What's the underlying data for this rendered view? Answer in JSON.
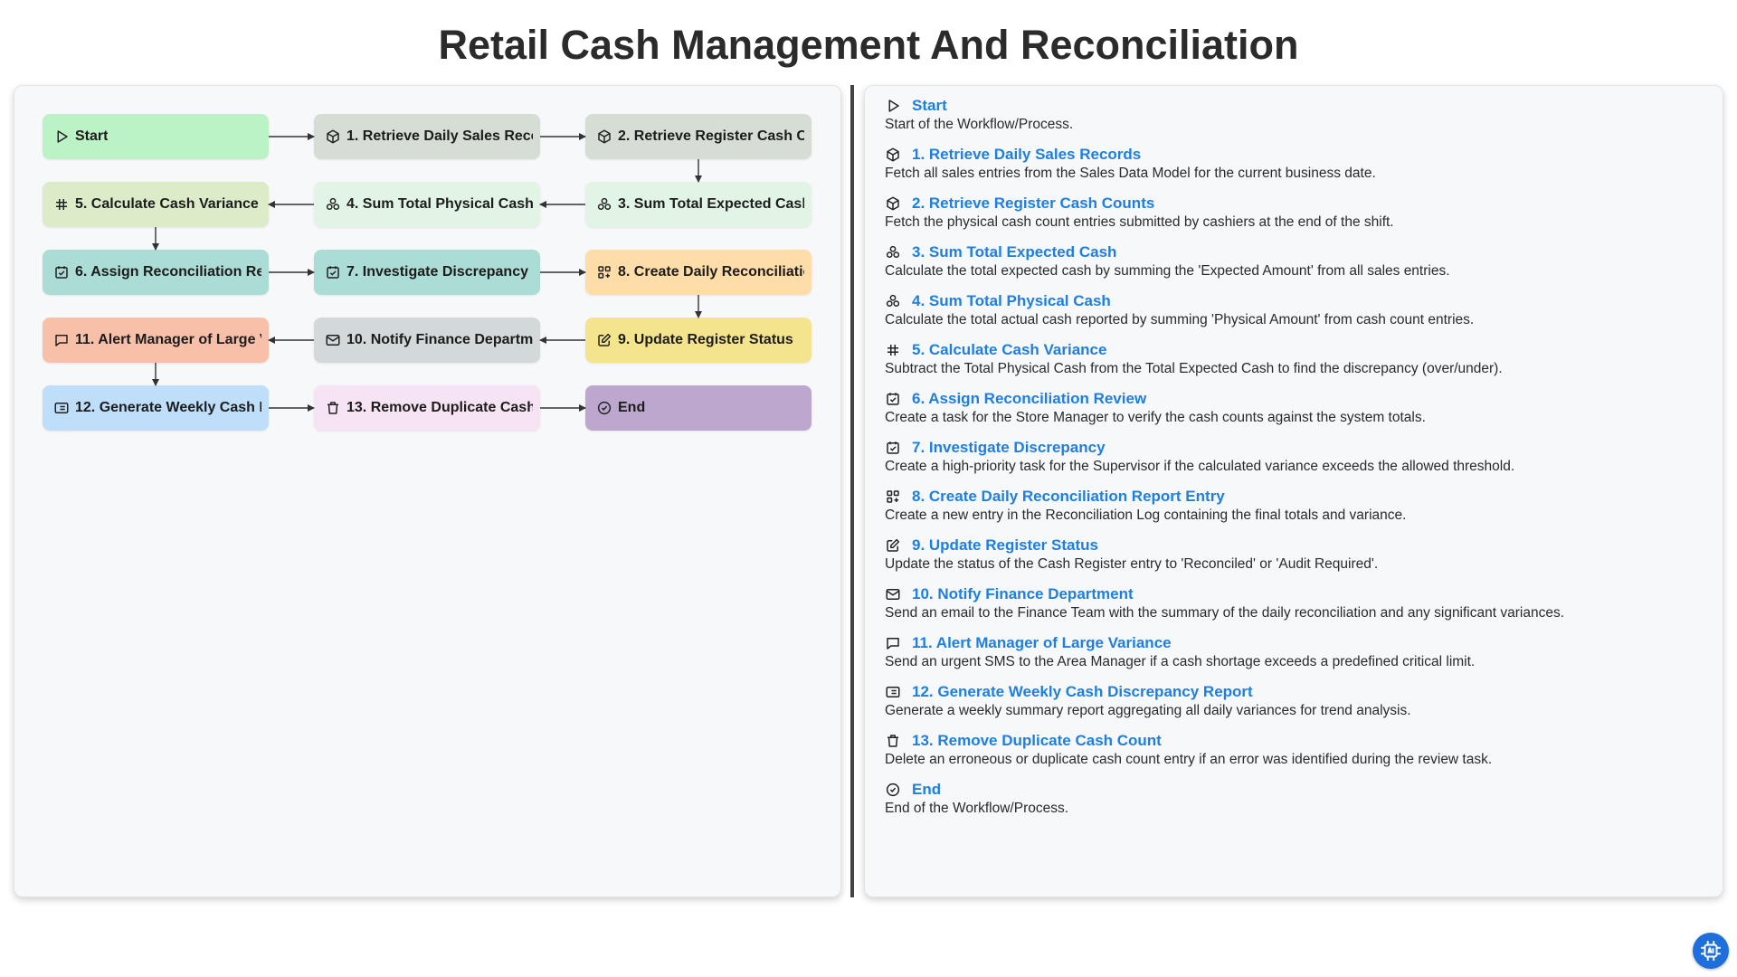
{
  "title": "Retail Cash Management And Reconciliation",
  "colors": {
    "start": "#bcf3c6",
    "retrieve": "#d5ddd4",
    "sum": "#e2f4e6",
    "calculate": "#dcebc8",
    "task": "#acdcd6",
    "report": "#fedda8",
    "update": "#f3e48d",
    "notify": "#d3d8da",
    "alert": "#f9c0a9",
    "weekly": "#bedefa",
    "remove": "#f6e3f3",
    "end": "#bea7cf",
    "link": "#1f7fe0"
  },
  "nodes": [
    {
      "id": "start",
      "label": "Start",
      "icon": "play-icon"
    },
    {
      "id": "s1",
      "label": "1. Retrieve Daily Sales Records",
      "icon": "cube-icon"
    },
    {
      "id": "s2",
      "label": "2. Retrieve Register Cash Counts",
      "icon": "cube-icon"
    },
    {
      "id": "s3",
      "label": "3. Sum Total Expected Cash",
      "icon": "stack-icon"
    },
    {
      "id": "s4",
      "label": "4. Sum Total Physical Cash",
      "icon": "stack-icon"
    },
    {
      "id": "s5",
      "label": "5. Calculate Cash Variance",
      "icon": "hash-icon"
    },
    {
      "id": "s6",
      "label": "6. Assign Reconciliation Review",
      "icon": "checkbox-icon"
    },
    {
      "id": "s7",
      "label": "7. Investigate Discrepancy",
      "icon": "checkbox-icon"
    },
    {
      "id": "s8",
      "label": "8. Create Daily Reconciliation Report Entry",
      "icon": "grid-icon"
    },
    {
      "id": "s9",
      "label": "9. Update Register Status",
      "icon": "edit-icon"
    },
    {
      "id": "s10",
      "label": "10. Notify Finance Department",
      "icon": "mail-icon"
    },
    {
      "id": "s11",
      "label": "11. Alert Manager of Large Variance",
      "icon": "message-icon"
    },
    {
      "id": "s12",
      "label": "12. Generate Weekly Cash Discrepancy Report",
      "icon": "list-icon"
    },
    {
      "id": "s13",
      "label": "13. Remove Duplicate Cash Count",
      "icon": "trash-icon"
    },
    {
      "id": "end",
      "label": "End",
      "icon": "check-circle-icon"
    }
  ],
  "steps": [
    {
      "title": "Start",
      "desc": "Start of the Workflow/Process."
    },
    {
      "title": "1. Retrieve Daily Sales Records",
      "desc": "Fetch all sales entries from the Sales Data Model for the current business date."
    },
    {
      "title": "2. Retrieve Register Cash Counts",
      "desc": "Fetch the physical cash count entries submitted by cashiers at the end of the shift."
    },
    {
      "title": "3. Sum Total Expected Cash",
      "desc": "Calculate the total expected cash by summing the 'Expected Amount' from all sales entries."
    },
    {
      "title": "4. Sum Total Physical Cash",
      "desc": "Calculate the total actual cash reported by summing 'Physical Amount' from cash count entries."
    },
    {
      "title": "5. Calculate Cash Variance",
      "desc": "Subtract the Total Physical Cash from the Total Expected Cash to find the discrepancy (over/under)."
    },
    {
      "title": "6. Assign Reconciliation Review",
      "desc": "Create a task for the Store Manager to verify the cash counts against the system totals."
    },
    {
      "title": "7. Investigate Discrepancy",
      "desc": "Create a high-priority task for the Supervisor if the calculated variance exceeds the allowed threshold."
    },
    {
      "title": "8. Create Daily Reconciliation Report Entry",
      "desc": "Create a new entry in the Reconciliation Log containing the final totals and variance."
    },
    {
      "title": "9. Update Register Status",
      "desc": "Update the status of the Cash Register entry to 'Reconciled' or 'Audit Required'."
    },
    {
      "title": "10. Notify Finance Department",
      "desc": "Send an email to the Finance Team with the summary of the daily reconciliation and any significant variances."
    },
    {
      "title": "11. Alert Manager of Large Variance",
      "desc": "Send an urgent SMS to the Area Manager if a cash shortage exceeds a predefined critical limit."
    },
    {
      "title": "12. Generate Weekly Cash Discrepancy Report",
      "desc": "Generate a weekly summary report aggregating all daily variances for trend analysis."
    },
    {
      "title": "13. Remove Duplicate Cash Count",
      "desc": "Delete an erroneous or duplicate cash count entry if an error was identified during the review task."
    },
    {
      "title": "End",
      "desc": "End of the Workflow/Process."
    }
  ]
}
